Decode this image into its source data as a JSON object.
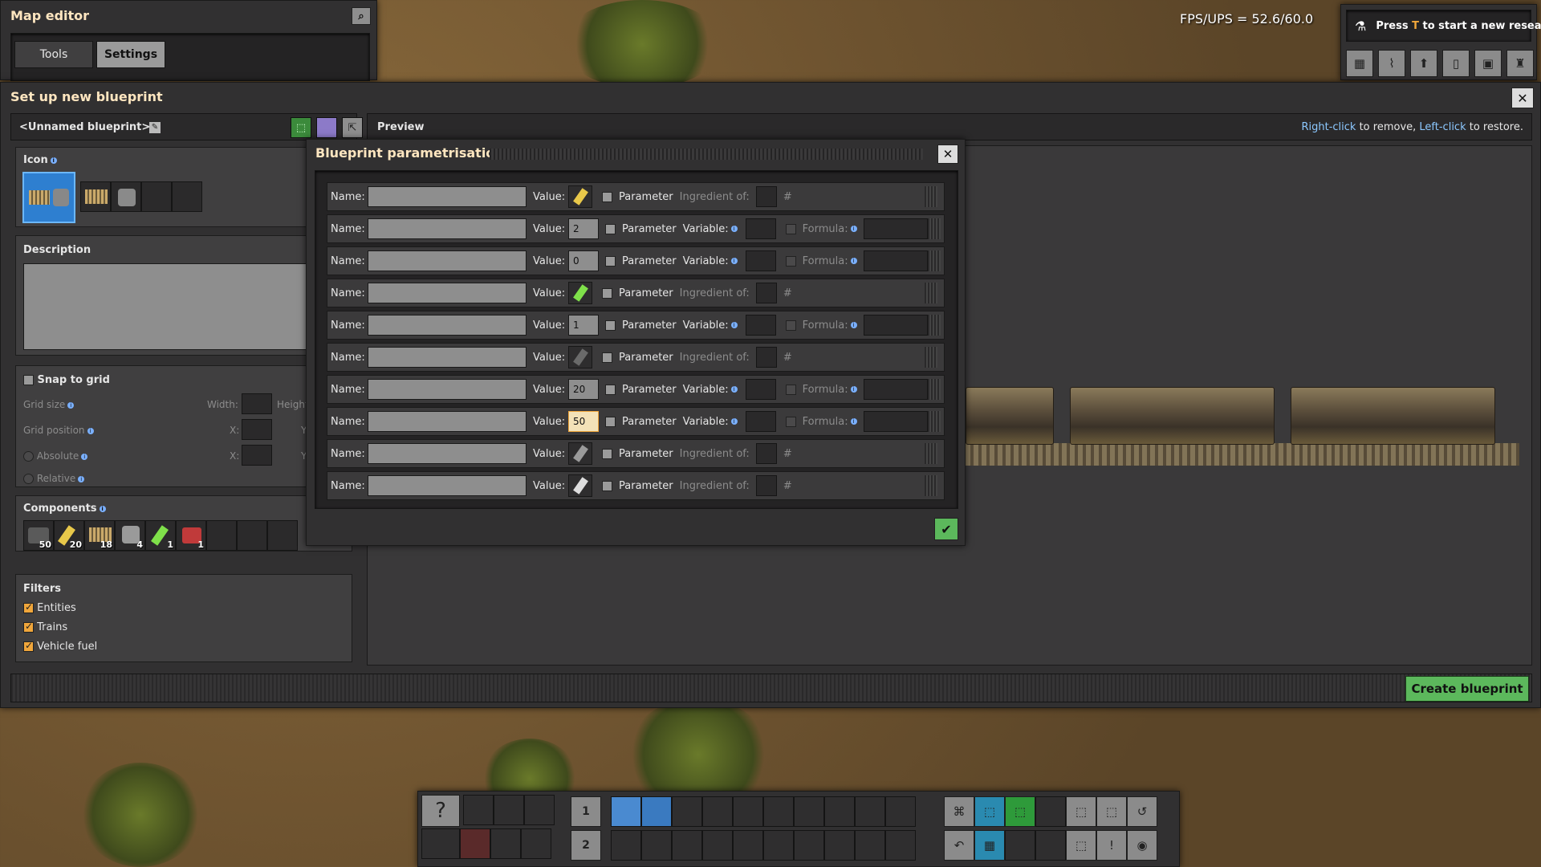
{
  "map_editor": {
    "title": "Map editor",
    "tabs": [
      {
        "label": "Tools"
      },
      {
        "label": "Settings"
      }
    ]
  },
  "fps": "FPS/UPS = 52.6/60.0",
  "research": {
    "text_pre": "Press ",
    "key": "T",
    "text_post": " to start a new research."
  },
  "top_icons": [
    "map-icon",
    "stats-icon",
    "logistics-icon",
    "book-icon",
    "train-icon",
    "trophy-icon"
  ],
  "blueprint_window": {
    "title": "Set up new blueprint",
    "name_label": "<Unnamed blueprint>",
    "preview_label": "Preview",
    "hint": {
      "right_click": "Right-click",
      "remove": " to remove, ",
      "left_click": "Left-click",
      "restore": " to restore."
    },
    "icon_label": "Icon",
    "description_label": "Description",
    "snap_to_grid": "Snap to grid",
    "grid_size": "Grid size",
    "width_label": "Width:",
    "height_label": "Height",
    "grid_position": "Grid position",
    "x_label": "X:",
    "y_label": "Y",
    "absolute": "Absolute",
    "relative": "Relative",
    "components_label": "Components",
    "components": [
      {
        "icon": "locomotive-icon",
        "count": "50"
      },
      {
        "icon": "rocket-fuel-icon",
        "count": "20"
      },
      {
        "icon": "cargo-wagon-icon",
        "count": "18"
      },
      {
        "icon": "rail-icon",
        "count": "4"
      },
      {
        "icon": "nuclear-fuel-icon",
        "count": "1"
      },
      {
        "icon": "train-stop-icon",
        "count": "1"
      }
    ],
    "filters_label": "Filters",
    "filters": [
      {
        "label": "Entities",
        "checked": true
      },
      {
        "label": "Trains",
        "checked": true
      },
      {
        "label": "Vehicle fuel",
        "checked": true
      }
    ],
    "create_button": "Create blueprint"
  },
  "param_dialog": {
    "title": "Blueprint parametrisation",
    "name_label": "Name:",
    "value_label": "Value:",
    "parameter_label": "Parameter",
    "ingredient_label": "Ingredient of:",
    "variable_label": "Variable:",
    "formula_label": "Formula:",
    "hash": "#",
    "rows": [
      {
        "kind": "item",
        "value": "",
        "icon": "rocket-fuel-icon"
      },
      {
        "kind": "number",
        "value": "2"
      },
      {
        "kind": "number",
        "value": "0"
      },
      {
        "kind": "item",
        "value": "",
        "icon": "nuclear-fuel-icon"
      },
      {
        "kind": "number",
        "value": "1"
      },
      {
        "kind": "item",
        "value": "",
        "icon": "locomotive-icon"
      },
      {
        "kind": "number",
        "value": "20"
      },
      {
        "kind": "number",
        "value": "50",
        "focused": true
      },
      {
        "kind": "item",
        "value": "",
        "icon": "rail-icon"
      },
      {
        "kind": "item",
        "value": "",
        "icon": "layers-icon"
      }
    ]
  },
  "hotbar": {
    "row1": "1",
    "row2": "2",
    "help": "?"
  },
  "colors": {
    "accent": "#f0a63b",
    "green": "#5cb85c",
    "title": "#ffe6c0"
  }
}
